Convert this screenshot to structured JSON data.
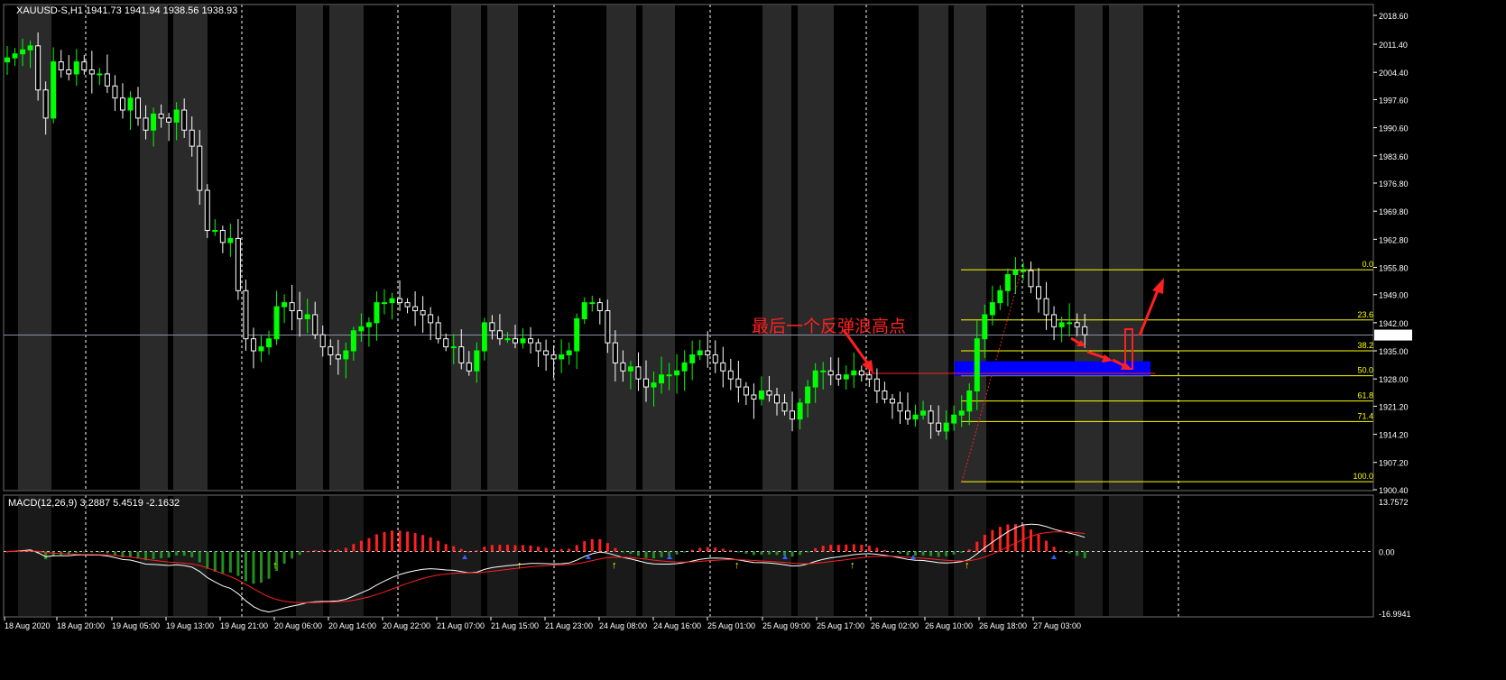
{
  "header": {
    "symbol_info": "XAUUSD-S,H1  1941.73 1941.94 1938.56 1938.93",
    "macd_info": "MACD(12,26,9) 3.2887 5.4519 -2.1632"
  },
  "annotation": {
    "text": "最后一个反弹浪高点"
  },
  "colors": {
    "background": "#000000",
    "bull_candle": "#00ff00",
    "bear_candle": "#ffffff",
    "night_band": "#2a2a2a",
    "grid": "#ffffff",
    "price_line": "#8a8fa8",
    "axis_text": "#ffffff",
    "fib": "#ffff00",
    "zone": "#0000ff",
    "arrow": "#ff2020",
    "macd_pos": "#ff2020",
    "macd_neg": "#1f8f1f",
    "macd_line": "#ffffff",
    "signal_line": "#ff2020",
    "marker_up": "#ffff00",
    "marker_blue": "#3060ff"
  },
  "chart_data": [
    {
      "type": "candlestick",
      "title": "XAUUSD-S,H1",
      "ohlc_last": {
        "open": 1941.73,
        "high": 1941.94,
        "low": 1938.56,
        "close": 1938.93
      },
      "current_price_label": "1938.93",
      "y_ticks": [
        "2018.60",
        "2011.40",
        "2004.40",
        "1997.60",
        "1990.60",
        "1983.60",
        "1976.80",
        "1969.80",
        "1962.80",
        "1955.80",
        "1949.00",
        "1942.00",
        "1935.00",
        "1928.00",
        "1921.20",
        "1914.20",
        "1907.20",
        "1900.40"
      ],
      "ylim": [
        1900.4,
        2018.6
      ],
      "x_ticks": [
        "18 Aug 2020",
        "18 Aug 20:00",
        "19 Aug 05:00",
        "19 Aug 13:00",
        "19 Aug 21:00",
        "20 Aug 06:00",
        "20 Aug 14:00",
        "20 Aug 22:00",
        "21 Aug 07:00",
        "21 Aug 15:00",
        "21 Aug 23:00",
        "24 Aug 08:00",
        "24 Aug 16:00",
        "25 Aug 01:00",
        "25 Aug 09:00",
        "25 Aug 17:00",
        "26 Aug 02:00",
        "26 Aug 10:00",
        "26 Aug 18:00",
        "27 Aug 03:00"
      ],
      "close_path": [
        2008,
        2009,
        2010,
        2011,
        2000,
        1993,
        2007,
        2005,
        2004,
        2007,
        2005,
        2004,
        2004,
        2001,
        1998,
        1995,
        1998,
        1993,
        1990,
        1994,
        1993,
        1992,
        1995,
        1990,
        1986,
        1975,
        1965,
        1965,
        1962,
        1963,
        1950,
        1938,
        1935,
        1936,
        1938,
        1946,
        1947,
        1945,
        1943,
        1944,
        1939,
        1936,
        1934,
        1933,
        1935,
        1940,
        1941,
        1942,
        1947,
        1947,
        1948,
        1947,
        1946,
        1945,
        1944,
        1942,
        1938,
        1936,
        1936,
        1932,
        1930,
        1935,
        1942,
        1940,
        1938,
        1938,
        1937,
        1938,
        1937,
        1935,
        1934,
        1933,
        1934,
        1935,
        1943,
        1947,
        1947,
        1945,
        1937,
        1932,
        1930,
        1931,
        1928,
        1926,
        1927,
        1929,
        1929,
        1930,
        1932,
        1934,
        1935,
        1934,
        1932,
        1930,
        1928,
        1926,
        1924,
        1923,
        1925,
        1924,
        1922,
        1920,
        1918,
        1922,
        1926,
        1930,
        1930,
        1929,
        1928,
        1929,
        1930,
        1929,
        1928,
        1925,
        1923,
        1922,
        1920,
        1918,
        1919,
        1920,
        1917,
        1915,
        1917,
        1919,
        1920,
        1925,
        1938,
        1944,
        1947,
        1950,
        1954,
        1955,
        1955,
        1951,
        1948,
        1944,
        1941,
        1942,
        1942,
        1941,
        1939
      ],
      "fibonacci": [
        {
          "level": "0.0",
          "price": 1955.2
        },
        {
          "level": "23.6",
          "price": 1942.7
        },
        {
          "level": "38.2",
          "price": 1935.0
        },
        {
          "level": "50.0",
          "price": 1928.8
        },
        {
          "level": "61.8",
          "price": 1922.5
        },
        {
          "level": "71.4",
          "price": 1917.4
        },
        {
          "level": "100.0",
          "price": 1902.4
        }
      ],
      "support_zone": {
        "from": 1928.8,
        "to": 1932.4
      },
      "horizontal_line": 1929.4
    },
    {
      "type": "bar+line",
      "title": "MACD(12,26,9) 3.2887 5.4519 -2.1632",
      "values": {
        "macd": 3.2887,
        "signal": 5.4519,
        "histogram": -2.1632
      },
      "y_ticks": [
        "13.7572",
        "0.00",
        "-16.9941"
      ],
      "ylim": [
        -16.9941,
        13.7572
      ]
    }
  ]
}
